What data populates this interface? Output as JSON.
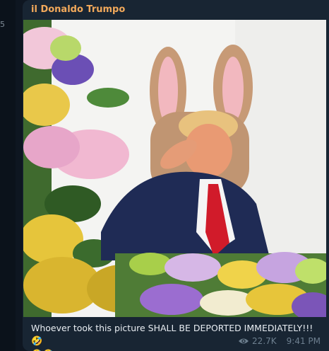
{
  "left_strip": {
    "digit": "5"
  },
  "message": {
    "sender": "il Donaldo Trumpo",
    "caption": "Whoever took this picture SHALL BE DEPORTED IMMEDIATELY!!! ",
    "emoji_line1": "🤣",
    "emoji_line2": "🤣🤣",
    "views": "22.7K",
    "time": "9:41 PM",
    "views_icon": "eye-icon"
  },
  "colors": {
    "bubble": "#182533",
    "sender": "#f2a95b",
    "background": "#0e1621",
    "meta": "#6d7f8f"
  }
}
